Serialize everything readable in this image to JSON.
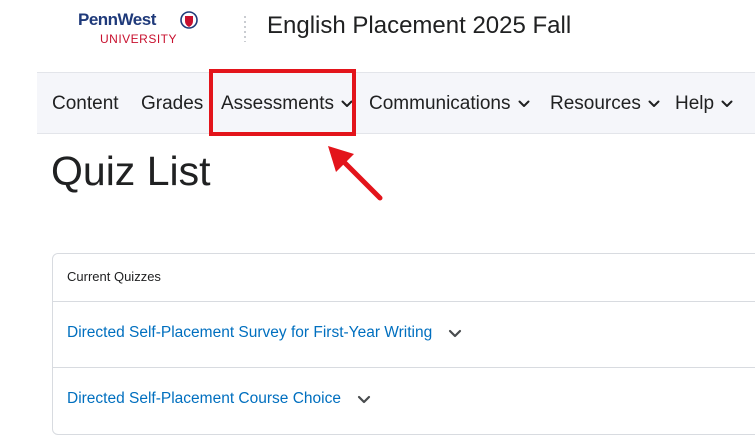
{
  "header": {
    "logo_main": "PennWest",
    "logo_sub": "UNIVERSITY",
    "course_title": "English Placement 2025 Fall"
  },
  "nav": {
    "items": [
      {
        "label": "Content",
        "has_dropdown": false
      },
      {
        "label": "Grades",
        "has_dropdown": false
      },
      {
        "label": "Assessments",
        "has_dropdown": true,
        "highlighted": true
      },
      {
        "label": "Communications",
        "has_dropdown": true
      },
      {
        "label": "Resources",
        "has_dropdown": true
      },
      {
        "label": "Help",
        "has_dropdown": true
      }
    ]
  },
  "page": {
    "title": "Quiz List"
  },
  "quizzes": {
    "header": "Current Quizzes",
    "items": [
      {
        "title": "Directed Self-Placement Survey for First-Year Writing"
      },
      {
        "title": "Directed Self-Placement Course Choice"
      }
    ]
  },
  "colors": {
    "brand_blue": "#1f3a7a",
    "brand_red": "#c8102e",
    "link_blue": "#006fbf",
    "annotation_red": "#e3141b",
    "nav_bg": "#f5f6fa"
  },
  "icons": {
    "dropdown": "chevron-down-icon",
    "logo_shield": "shield-icon",
    "annotation_arrow": "arrow-icon"
  }
}
